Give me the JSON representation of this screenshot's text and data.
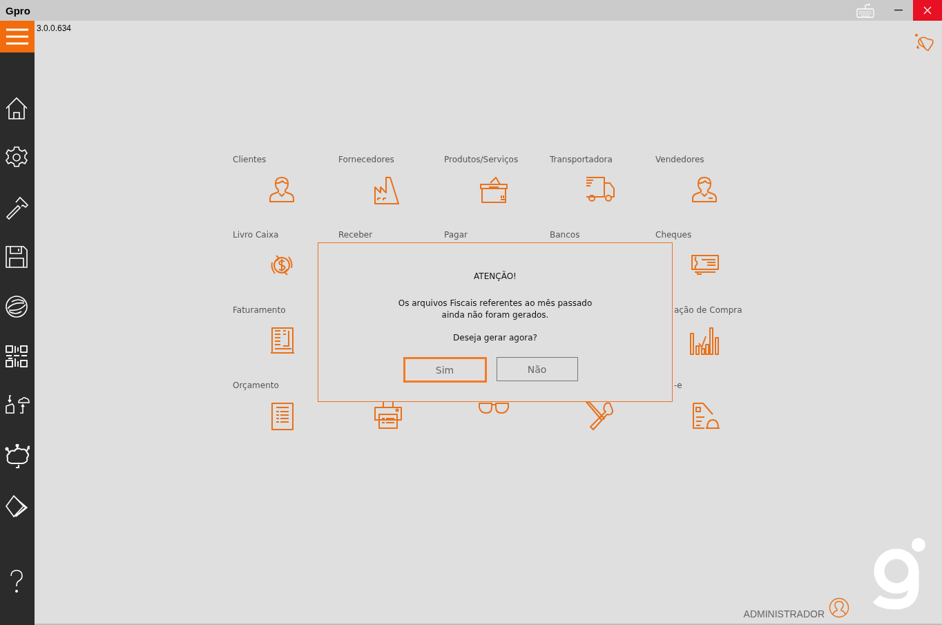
{
  "window": {
    "title": "Gpro",
    "version": "3.0.0.634"
  },
  "sidebar": {
    "items": [
      {
        "kind": "home"
      },
      {
        "kind": "gear"
      },
      {
        "kind": "hammer"
      },
      {
        "kind": "floppy"
      },
      {
        "kind": "swirl"
      },
      {
        "kind": "qr"
      },
      {
        "kind": "sync"
      },
      {
        "kind": "network"
      },
      {
        "kind": "book"
      },
      {
        "kind": "help"
      }
    ]
  },
  "modules": [
    {
      "label": "Clientes",
      "kind": "person",
      "partly_hidden": false
    },
    {
      "label": "Fornecedores",
      "kind": "factory",
      "partly_hidden": false
    },
    {
      "label": "Produtos/Serviços",
      "kind": "box",
      "partly_hidden": false
    },
    {
      "label": "Transportadora",
      "kind": "truck",
      "partly_hidden": false
    },
    {
      "label": "Vendedores",
      "kind": "salesman",
      "partly_hidden": false
    },
    {
      "label": "Livro Caixa",
      "kind": "cash",
      "partly_hidden": false
    },
    {
      "label": "Receber",
      "partly_hidden": false
    },
    {
      "label": "Pagar",
      "partly_hidden": false
    },
    {
      "label": "Bancos",
      "partly_hidden": false
    },
    {
      "label": "Cheques",
      "kind": "cheque",
      "partly_hidden": false
    },
    {
      "label": "Faturamento",
      "kind": "invoice",
      "partly_hidden": false
    },
    {
      "label": "ação de Compra",
      "kind": "chart",
      "partly_hidden": true
    },
    {
      "label": "Orçamento",
      "kind": "budget",
      "partly_hidden": false
    },
    {
      "kind": "printer",
      "partly_hidden": false
    },
    {
      "kind": "glasses",
      "partly_hidden": false
    },
    {
      "kind": "tools",
      "partly_hidden": false
    },
    {
      "label": "-e",
      "kind": "report",
      "partly_hidden": true
    }
  ],
  "dialog": {
    "title": "ATENÇÃO!",
    "message": "Os arquivos Fiscais referentes ao mês passado\nainda não foram gerados.",
    "question": "Deseja gerar agora?",
    "buttons": [
      {
        "label": "Sim",
        "focused": true
      },
      {
        "label": "Não",
        "focused": false
      }
    ]
  },
  "footer": {
    "user": "ADMINISTRADOR"
  }
}
